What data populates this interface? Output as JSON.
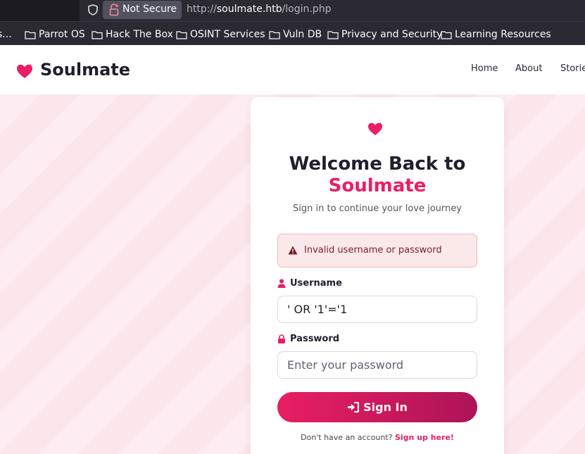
{
  "browser": {
    "security_label": "Not Secure",
    "url_scheme": "http://",
    "url_host": "soulmate.htb",
    "url_path": "/login.php",
    "bookmarks": [
      "s...",
      "Parrot OS",
      "Hack The Box",
      "OSINT Services",
      "Vuln DB",
      "Privacy and Security",
      "Learning Resources"
    ]
  },
  "header": {
    "brand": "Soulmate",
    "nav": [
      "Home",
      "About",
      "Storie"
    ]
  },
  "login": {
    "title_line1": "Welcome Back to",
    "title_line2": "Soulmate",
    "subtitle": "Sign in to continue your love journey",
    "error": "Invalid username or password",
    "username_label": "Username",
    "username_value": "' OR '1'='1",
    "password_label": "Password",
    "password_placeholder": "Enter your password",
    "submit_label": "Sign In",
    "signup_prompt": "Don't have an account?",
    "signup_link": "Sign up here!"
  },
  "colors": {
    "accent": "#e91e63",
    "accent_dark": "#ad1457",
    "error_bg": "#fbe9ea",
    "error_text": "#7a1d26"
  }
}
